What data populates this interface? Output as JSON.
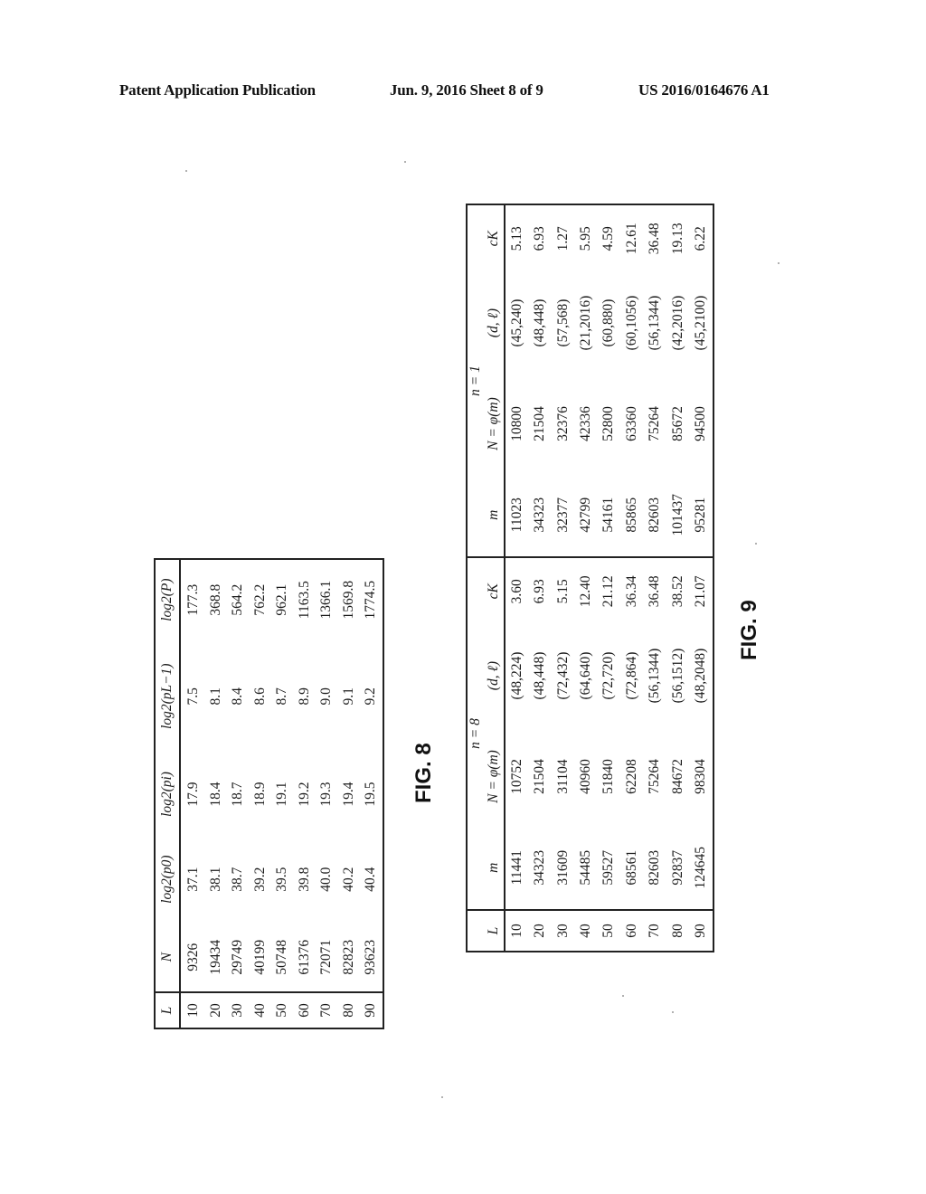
{
  "header": {
    "left": "Patent Application Publication",
    "center": "Jun. 9, 2016   Sheet 8 of 9",
    "right": "US 2016/0164676 A1"
  },
  "fig8": {
    "label": "FIG. 8",
    "columns": [
      "L",
      "N",
      "log2(p0)",
      "log2(pi)",
      "log2(pL−1)",
      "log2(P)"
    ],
    "rows": [
      [
        "10",
        "9326",
        "37.1",
        "17.9",
        "7.5",
        "177.3"
      ],
      [
        "20",
        "19434",
        "38.1",
        "18.4",
        "8.1",
        "368.8"
      ],
      [
        "30",
        "29749",
        "38.7",
        "18.7",
        "8.4",
        "564.2"
      ],
      [
        "40",
        "40199",
        "39.2",
        "18.9",
        "8.6",
        "762.2"
      ],
      [
        "50",
        "50748",
        "39.5",
        "19.1",
        "8.7",
        "962.1"
      ],
      [
        "60",
        "61376",
        "39.8",
        "19.2",
        "8.9",
        "1163.5"
      ],
      [
        "70",
        "72071",
        "40.0",
        "19.3",
        "9.0",
        "1366.1"
      ],
      [
        "80",
        "82823",
        "40.2",
        "19.4",
        "9.1",
        "1569.8"
      ],
      [
        "90",
        "93623",
        "40.4",
        "19.5",
        "9.2",
        "1774.5"
      ]
    ]
  },
  "fig9": {
    "label": "FIG. 9",
    "group_headers": [
      "n = 8",
      "n = 1"
    ],
    "columns": [
      "L",
      "m",
      "N = φ(m)",
      "(d, ℓ)",
      "cK",
      "m",
      "N = φ(m)",
      "(d, ℓ)",
      "cK"
    ],
    "rows": [
      [
        "10",
        "11441",
        "10752",
        "(48,224)",
        "3.60",
        "11023",
        "10800",
        "(45,240)",
        "5.13"
      ],
      [
        "20",
        "34323",
        "21504",
        "(48,448)",
        "6.93",
        "34323",
        "21504",
        "(48,448)",
        "6.93"
      ],
      [
        "30",
        "31609",
        "31104",
        "(72,432)",
        "5.15",
        "32377",
        "32376",
        "(57,568)",
        "1.27"
      ],
      [
        "40",
        "54485",
        "40960",
        "(64,640)",
        "12.40",
        "42799",
        "42336",
        "(21,2016)",
        "5.95"
      ],
      [
        "50",
        "59527",
        "51840",
        "(72,720)",
        "21.12",
        "54161",
        "52800",
        "(60,880)",
        "4.59"
      ],
      [
        "60",
        "68561",
        "62208",
        "(72,864)",
        "36.34",
        "85865",
        "63360",
        "(60,1056)",
        "12.61"
      ],
      [
        "70",
        "82603",
        "75264",
        "(56,1344)",
        "36.48",
        "82603",
        "75264",
        "(56,1344)",
        "36.48"
      ],
      [
        "80",
        "92837",
        "84672",
        "(56,1512)",
        "38.52",
        "101437",
        "85672",
        "(42,2016)",
        "19.13"
      ],
      [
        "90",
        "124645",
        "98304",
        "(48,2048)",
        "21.07",
        "95281",
        "94500",
        "(45,2100)",
        "6.22"
      ]
    ]
  }
}
